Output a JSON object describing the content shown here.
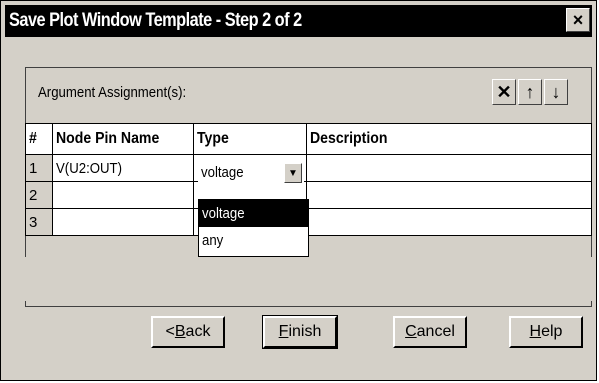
{
  "window": {
    "title": "Save Plot Window Template - Step 2 of 2",
    "close_label": "×"
  },
  "group": {
    "label": "Argument Assignment(s):",
    "tools": [
      {
        "name": "delete-icon",
        "glyph": "✕"
      },
      {
        "name": "arrow-up-icon",
        "glyph": "↑"
      },
      {
        "name": "arrow-down-icon",
        "glyph": "↓"
      }
    ]
  },
  "table": {
    "headers": [
      "#",
      "Node Pin Name",
      "Type",
      "Description"
    ],
    "rows": [
      {
        "num": "1",
        "node": "V(U2:OUT)",
        "type": "voltage",
        "desc": ""
      },
      {
        "num": "2",
        "node": "",
        "type": "",
        "desc": ""
      },
      {
        "num": "3",
        "node": "",
        "type": "",
        "desc": ""
      }
    ]
  },
  "dropdown": {
    "selected": "voltage",
    "options": [
      "voltage",
      "any"
    ],
    "highlighted": "voltage"
  },
  "buttons": {
    "back": {
      "prefix": "<",
      "mnemonic": "B",
      "rest": "ack"
    },
    "finish": {
      "mnemonic": "F",
      "rest": "inish"
    },
    "cancel": {
      "mnemonic": "C",
      "rest": "ancel"
    },
    "help": {
      "mnemonic": "H",
      "rest": "elp"
    }
  }
}
